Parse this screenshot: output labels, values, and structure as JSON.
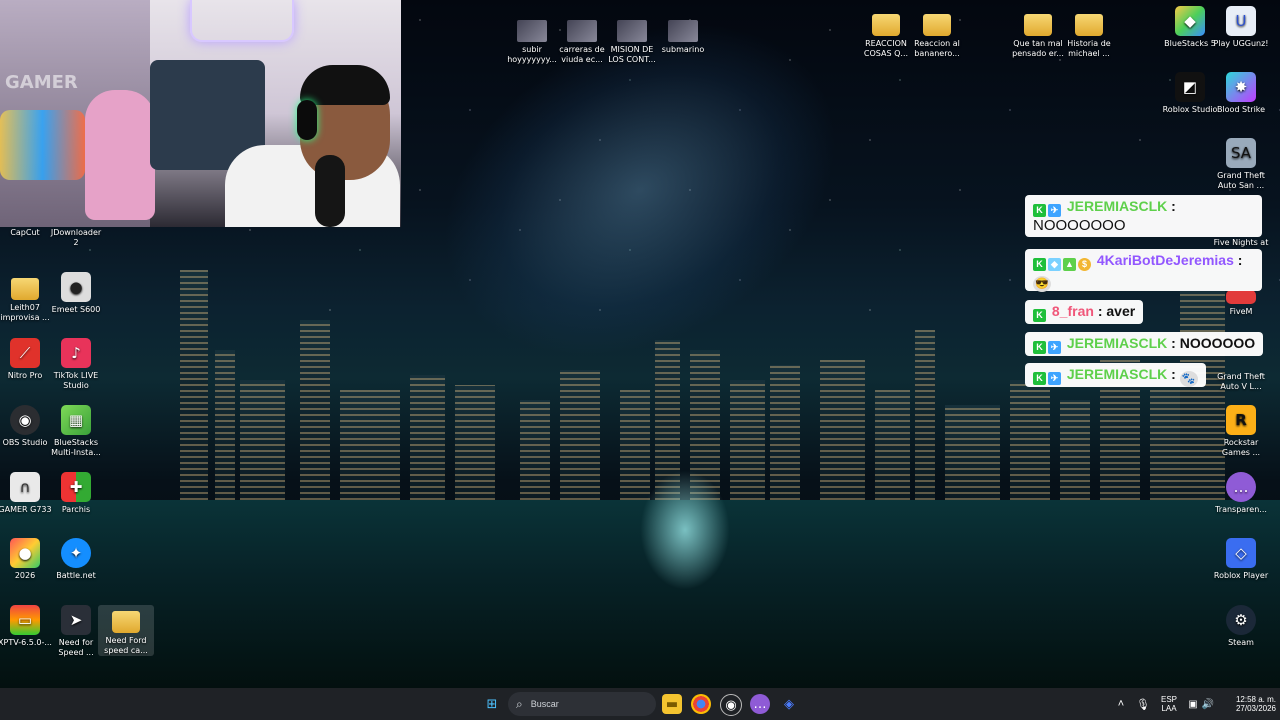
{
  "desktop": {
    "left_icons": [
      {
        "label": "CapCut",
        "icon": "capcut-icon"
      },
      {
        "label": "JDownloader 2",
        "icon": "jdownloader-icon"
      },
      {
        "label": "Leith07 improvisa ...",
        "icon": "folder-icon"
      },
      {
        "label": "Emeet S600",
        "icon": "webcam-icon"
      },
      {
        "label": "Nitro Pro",
        "icon": "nitro-pdf-icon"
      },
      {
        "label": "TikTok LIVE Studio",
        "icon": "tiktok-icon"
      },
      {
        "label": "OBS Studio",
        "icon": "obs-icon"
      },
      {
        "label": "BlueStacks Multi-Insta...",
        "icon": "bluestacks-multi-icon"
      },
      {
        "label": "GAMER G733",
        "icon": "headset-icon"
      },
      {
        "label": "Parchis",
        "icon": "parchis-icon"
      },
      {
        "label": "2026",
        "icon": "ball-icon"
      },
      {
        "label": "Battle.net",
        "icon": "battlenet-icon"
      },
      {
        "label": "XPTV-6.5.0-...",
        "icon": "xptv-icon"
      },
      {
        "label": "Need for Speed ...",
        "icon": "nfs-icon"
      },
      {
        "label": "Need Ford speed ca...",
        "icon": "folder-icon"
      }
    ],
    "top_icons": [
      {
        "label": "subir hoyyyyyyy...",
        "icon": "video-icon"
      },
      {
        "label": "carreras de viuda ec...",
        "icon": "video-icon"
      },
      {
        "label": "MISION DE LOS CONT...",
        "icon": "video-icon"
      },
      {
        "label": "submarino",
        "icon": "video-icon"
      },
      {
        "label": "REACCION COSAS Q...",
        "icon": "folder-icon"
      },
      {
        "label": "Reaccion al bananero...",
        "icon": "folder-icon"
      },
      {
        "label": "Que tan mal pensado er...",
        "icon": "folder-icon"
      },
      {
        "label": "Historia de michael ...",
        "icon": "folder-icon"
      }
    ],
    "right_icons": [
      {
        "label": "BlueStacks 5",
        "icon": "bluestacks-icon"
      },
      {
        "label": "Play UGGunz!",
        "icon": "uggunz-icon"
      },
      {
        "label": "Roblox Studio",
        "icon": "roblox-studio-icon"
      },
      {
        "label": "Blood Strike",
        "icon": "blood-strike-icon"
      },
      {
        "label": "Grand Theft Auto San ...",
        "icon": "gta-icon"
      },
      {
        "label": "Five Nights at",
        "icon": "fnaf-icon"
      },
      {
        "label": "FiveM",
        "icon": "fivem-icon"
      },
      {
        "label": "Grand Theft Auto V L...",
        "icon": "gta5-icon"
      },
      {
        "label": "Rockstar Games ...",
        "icon": "rockstar-icon"
      },
      {
        "label": "Transparen...",
        "icon": "chat-bubble-icon"
      },
      {
        "label": "Roblox Player",
        "icon": "roblox-icon"
      },
      {
        "label": "Steam",
        "icon": "steam-icon"
      }
    ]
  },
  "webcam": {
    "overlay_text": "GAMER"
  },
  "chat": {
    "messages": [
      {
        "user": "JEREMIASCLK",
        "sep": ":",
        "text": "NOOOOOOO"
      },
      {
        "user": "4KariBotDeJeremias",
        "sep": ":",
        "text": ""
      },
      {
        "user": "8_fran",
        "sep": ":",
        "text": "aver"
      },
      {
        "user": "JEREMIASCLK",
        "sep": ":",
        "text": "NOOOOOO"
      },
      {
        "user": "JEREMIASCLK",
        "sep": ":",
        "text": ""
      }
    ]
  },
  "taskbar": {
    "search_placeholder": "Buscar",
    "language": "ESP",
    "layout": "LAA",
    "time": "12:58 a. m.",
    "date": "27/03/2026"
  },
  "colors": {
    "taskbar": "#1f2226",
    "chat_user_green": "#5ed04b",
    "chat_user_purple": "#9256ff",
    "chat_user_pink": "#f0577a"
  }
}
